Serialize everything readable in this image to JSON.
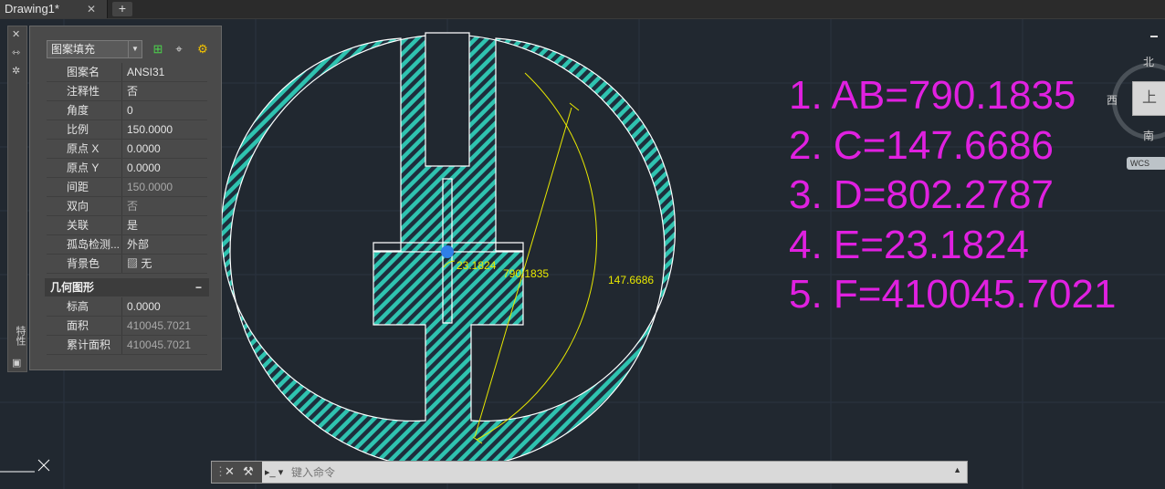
{
  "tab": {
    "title": "Drawing1*",
    "close": "✕",
    "add": "+"
  },
  "properties": {
    "combo_value": "图案填充",
    "rows": [
      {
        "key": "图案名",
        "value": "ANSI31"
      },
      {
        "key": "注释性",
        "value": "否"
      },
      {
        "key": "角度",
        "value": "0"
      },
      {
        "key": "比例",
        "value": "150.0000"
      },
      {
        "key": "原点 X",
        "value": "0.0000"
      },
      {
        "key": "原点 Y",
        "value": "0.0000"
      },
      {
        "key": "间距",
        "value": "150.0000"
      },
      {
        "key": "双向",
        "value": "否"
      },
      {
        "key": "关联",
        "value": "是"
      },
      {
        "key": "孤岛检测...",
        "value": "外部"
      },
      {
        "key": "背景色",
        "value": "无"
      }
    ],
    "geometry_section": "几何图形",
    "geometry_rows": [
      {
        "key": "标高",
        "value": "0.0000"
      },
      {
        "key": "面积",
        "value": "410045.7021"
      },
      {
        "key": "累计面积",
        "value": "410045.7021"
      }
    ],
    "side_label": "特性"
  },
  "dimensions": {
    "e": "23.1824",
    "ab": "790.1835",
    "c": "147.6686"
  },
  "results": [
    "1. AB=790.1835",
    "2. C=147.6686",
    "3. D=802.2787",
    "4. E=23.1824",
    "5. F=410045.7021"
  ],
  "viewcube": {
    "north": "北",
    "west": "西",
    "south": "南",
    "top": "上",
    "wcs": "WCS"
  },
  "command": {
    "placeholder": "键入命令"
  },
  "colors": {
    "hatch": "#2fc3b0",
    "dimension": "#e8e800",
    "result_text": "#e020e0",
    "canvas": "#212830"
  }
}
